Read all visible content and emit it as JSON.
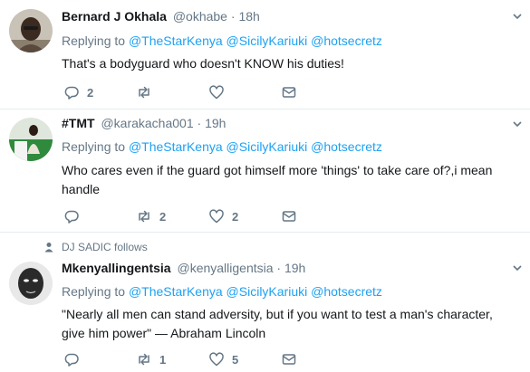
{
  "colors": {
    "link": "#1da1f2",
    "secondary": "#657786",
    "text": "#14171a",
    "divider": "#e6ecf0"
  },
  "tweets": [
    {
      "name": "Bernard J Okhala",
      "handle": "@okhabe",
      "dot": "·",
      "time": "18h",
      "replying_prefix": "Replying to",
      "mentions": [
        "@TheStarKenya",
        "@SicilyKariuki",
        "@hotsecretz"
      ],
      "text": "That's a bodyguard who doesn't KNOW his duties!",
      "replies": "2",
      "retweets": "",
      "likes": ""
    },
    {
      "name": "#TMT",
      "handle": "@karakacha001",
      "dot": "·",
      "time": "19h",
      "replying_prefix": "Replying to",
      "mentions": [
        "@TheStarKenya",
        "@SicilyKariuki",
        "@hotsecretz"
      ],
      "text": "Who cares even if the guard got himself more 'things' to take care of?,i mean handle",
      "replies": "",
      "retweets": "2",
      "likes": "2"
    },
    {
      "social_context": "DJ SADIC follows",
      "name": "Mkenyallingentsia",
      "handle": "@kenyalligentsia",
      "dot": "·",
      "time": "19h",
      "replying_prefix": "Replying to",
      "mentions": [
        "@TheStarKenya",
        "@SicilyKariuki",
        "@hotsecretz"
      ],
      "text": "\"Nearly all men can stand adversity, but if you want to test a man's character, give him power\" — Abraham Lincoln",
      "replies": "",
      "retweets": "1",
      "likes": "5"
    }
  ],
  "icons": {
    "reply": "reply-icon",
    "retweet": "retweet-icon",
    "like": "heart-icon",
    "dm": "envelope-icon",
    "caret": "chevron-down-icon",
    "follow": "person-icon"
  }
}
